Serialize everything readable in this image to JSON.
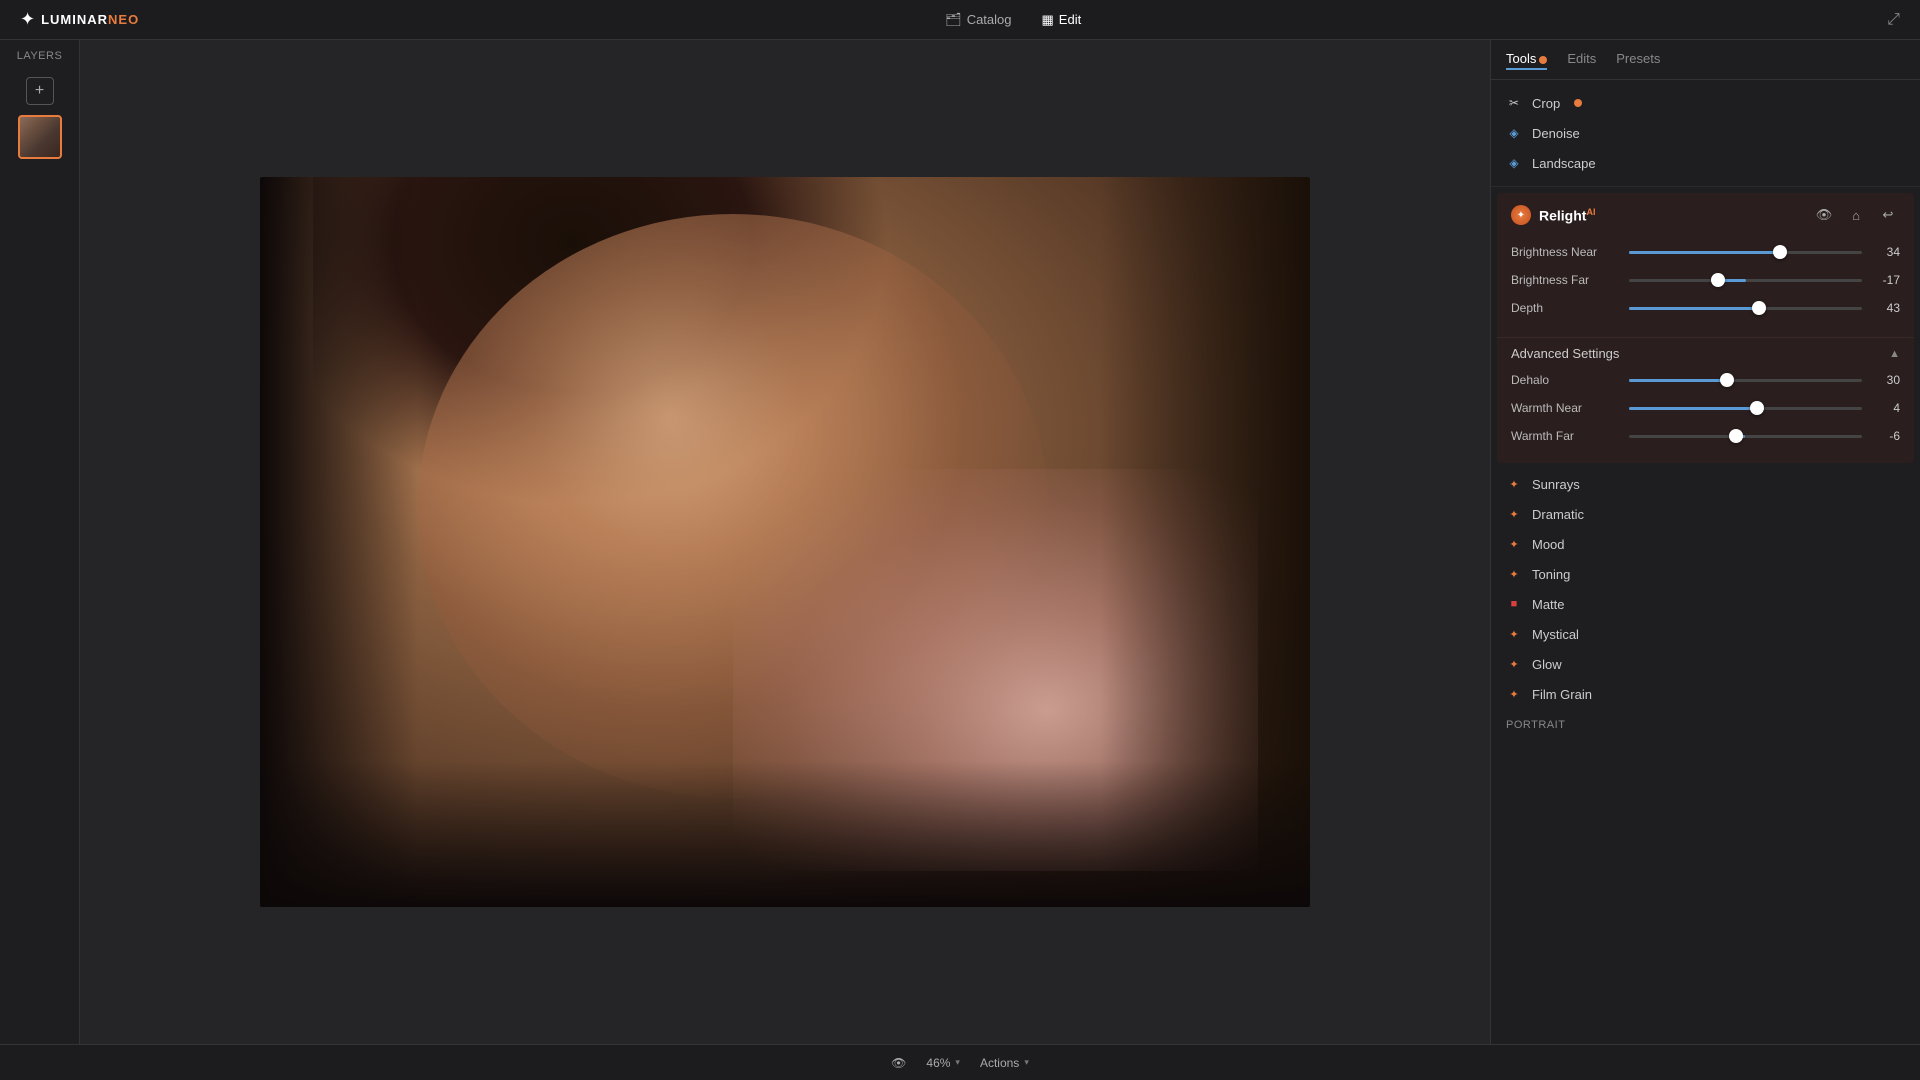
{
  "app": {
    "name": "LUMINAR",
    "name_highlight": "NEO"
  },
  "topbar": {
    "nav_catalog": "Catalog",
    "nav_edit": "Edit",
    "catalog_icon": "🗂",
    "edit_icon": "▦"
  },
  "layers_panel": {
    "title": "Layers",
    "add_label": "+"
  },
  "canvas": {
    "zoom": "46%",
    "actions_label": "Actions"
  },
  "right_panel": {
    "tabs": [
      {
        "id": "tools",
        "label": "Tools",
        "active": true,
        "has_badge": true
      },
      {
        "id": "edits",
        "label": "Edits"
      },
      {
        "id": "presets",
        "label": "Presets"
      }
    ]
  },
  "tools": {
    "crop": {
      "label": "Crop",
      "has_badge": true
    },
    "denoise": {
      "label": "Denoise"
    },
    "landscape": {
      "label": "Landscape"
    }
  },
  "relight": {
    "title": "Relight",
    "ai_badge": "AI",
    "sliders": [
      {
        "id": "brightness_near",
        "label": "Brightness Near",
        "value": 34,
        "position": 65
      },
      {
        "id": "brightness_far",
        "label": "Brightness Far",
        "value": -17,
        "position": 38
      },
      {
        "id": "depth",
        "label": "Depth",
        "value": 43,
        "position": 56
      }
    ]
  },
  "advanced_settings": {
    "title": "Advanced Settings",
    "expanded": true,
    "sliders": [
      {
        "id": "dehalo",
        "label": "Dehalo",
        "value": 30,
        "position": 42
      },
      {
        "id": "warmth_near",
        "label": "Warmth Near",
        "value": 4,
        "position": 55
      },
      {
        "id": "warmth_far",
        "label": "Warmth Far",
        "value": -6,
        "position": 46
      }
    ]
  },
  "bottom_tools": [
    {
      "id": "sunrays",
      "label": "Sunrays",
      "icon_type": "orange"
    },
    {
      "id": "dramatic",
      "label": "Dramatic",
      "icon_type": "orange"
    },
    {
      "id": "mood",
      "label": "Mood",
      "icon_type": "orange"
    },
    {
      "id": "toning",
      "label": "Toning",
      "icon_type": "orange"
    },
    {
      "id": "matte",
      "label": "Matte",
      "icon_type": "red"
    },
    {
      "id": "mystical",
      "label": "Mystical",
      "icon_type": "orange"
    },
    {
      "id": "glow",
      "label": "Glow",
      "icon_type": "orange"
    },
    {
      "id": "film_grain",
      "label": "Film Grain",
      "icon_type": "orange"
    }
  ],
  "portrait_label": "Portrait"
}
